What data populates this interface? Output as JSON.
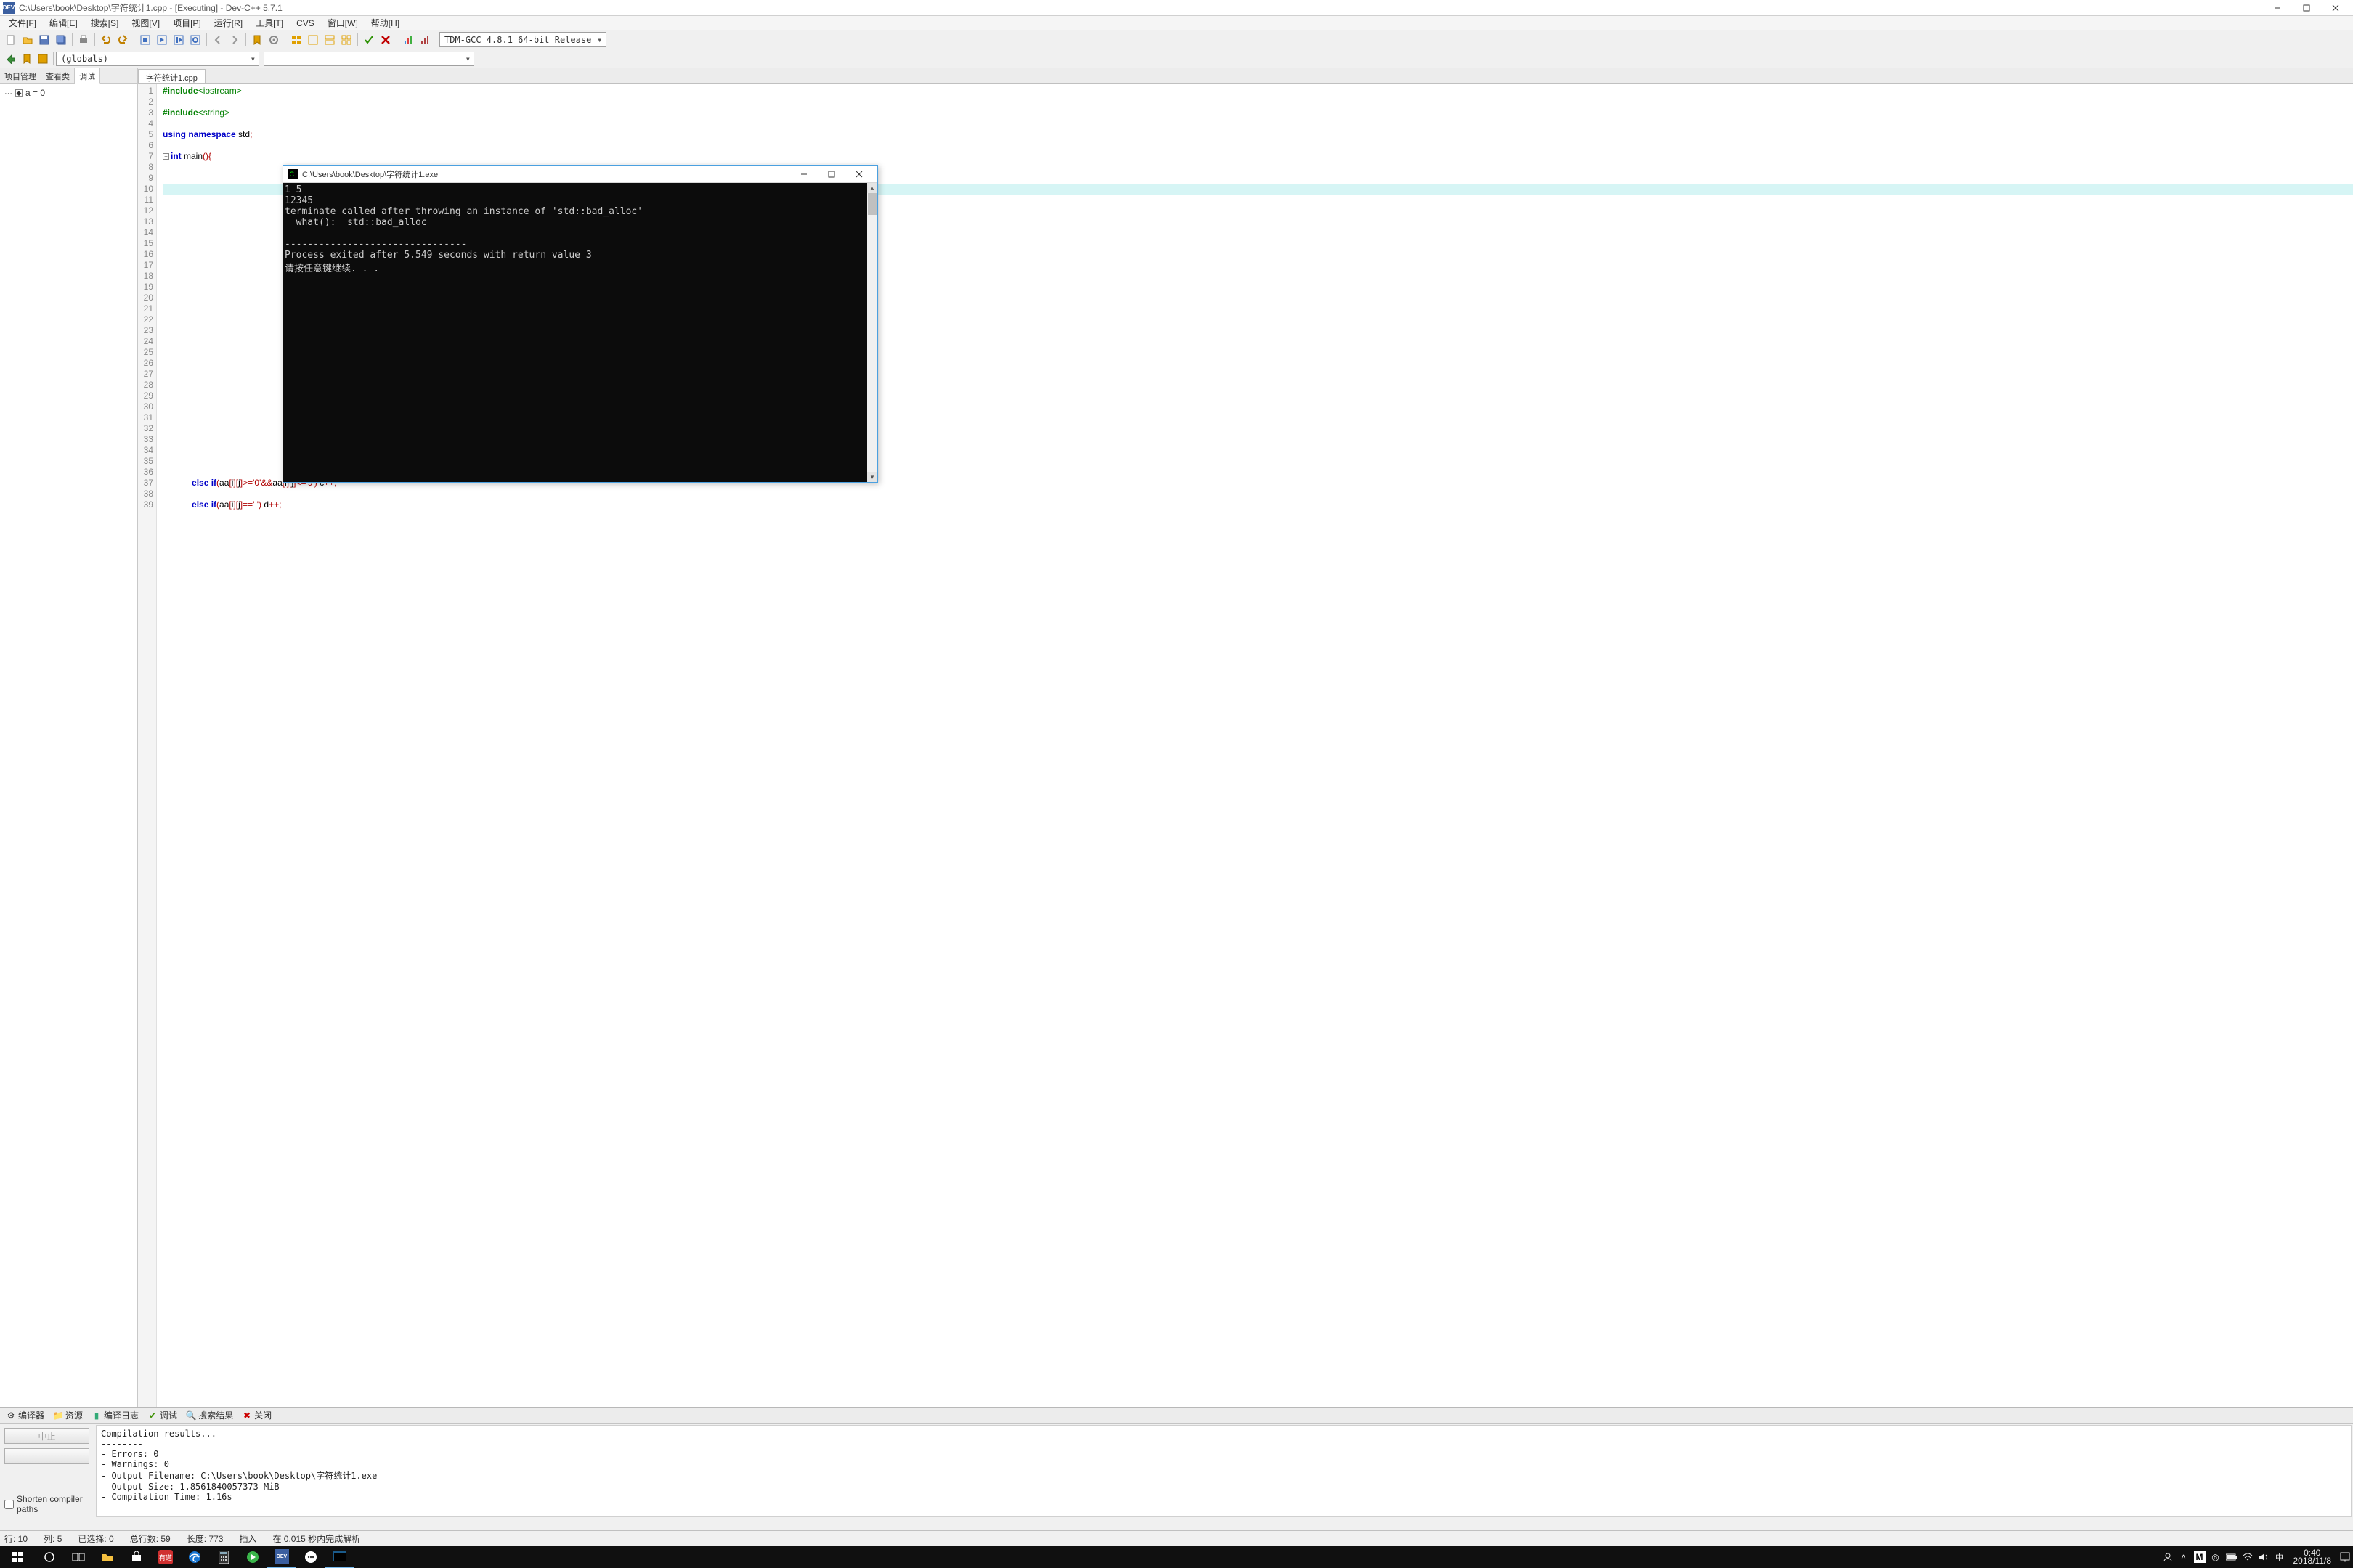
{
  "window": {
    "title": "C:\\Users\\book\\Desktop\\字符统计1.cpp - [Executing] - Dev-C++ 5.7.1",
    "app_icon_text": "DEV"
  },
  "menu": [
    "文件[F]",
    "编辑[E]",
    "搜索[S]",
    "视图[V]",
    "项目[P]",
    "运行[R]",
    "工具[T]",
    "CVS",
    "窗口[W]",
    "帮助[H]"
  ],
  "compiler_select": "TDM-GCC 4.8.1 64-bit Release",
  "scope_combo": "(globals)",
  "sidebar": {
    "tabs": [
      "项目管理",
      "查看类",
      "调试"
    ],
    "active_tab": 2,
    "tree_item": "a = 0"
  },
  "file_tab": "字符统计1.cpp",
  "code": {
    "lines": [
      {
        "n": 1,
        "html": "<span class='pp'>#include</span><span class='str'>&lt;iostream&gt;</span>"
      },
      {
        "n": 2,
        "html": ""
      },
      {
        "n": 3,
        "html": "<span class='pp'>#include</span><span class='str'>&lt;string&gt;</span>"
      },
      {
        "n": 4,
        "html": ""
      },
      {
        "n": 5,
        "html": "<span class='kw'>using</span> <span class='kw'>namespace</span> std<span class='op'>;</span>"
      },
      {
        "n": 6,
        "html": ""
      },
      {
        "n": 7,
        "html": "<span class='kw'>int</span> main<span class='op'>(){</span>",
        "fold": true
      },
      {
        "n": 8,
        "html": ""
      },
      {
        "n": 9,
        "html": ""
      },
      {
        "n": 10,
        "html": "",
        "hl": true
      },
      {
        "n": 11,
        "html": ""
      },
      {
        "n": 12,
        "html": ""
      },
      {
        "n": 13,
        "html": ""
      },
      {
        "n": 14,
        "html": ""
      },
      {
        "n": 15,
        "html": ""
      },
      {
        "n": 16,
        "html": ""
      },
      {
        "n": 17,
        "html": ""
      },
      {
        "n": 18,
        "html": ""
      },
      {
        "n": 19,
        "html": ""
      },
      {
        "n": 20,
        "html": ""
      },
      {
        "n": 21,
        "html": ""
      },
      {
        "n": 22,
        "html": ""
      },
      {
        "n": 23,
        "html": ""
      },
      {
        "n": 24,
        "html": ""
      },
      {
        "n": 25,
        "html": ""
      },
      {
        "n": 26,
        "html": ""
      },
      {
        "n": 27,
        "html": ""
      },
      {
        "n": 28,
        "html": ""
      },
      {
        "n": 29,
        "html": ""
      },
      {
        "n": 30,
        "html": ""
      },
      {
        "n": 31,
        "html": ""
      },
      {
        "n": 32,
        "html": ""
      },
      {
        "n": 33,
        "html": ""
      },
      {
        "n": 34,
        "html": ""
      },
      {
        "n": 35,
        "html": ""
      },
      {
        "n": 36,
        "html": ""
      },
      {
        "n": 37,
        "html": "            <span class='kw'>else if</span><span class='op'>(</span>aa<span class='op'>[</span>i<span class='op'>][</span>j<span class='op'>]&gt;=</span><span class='num'>'0'</span><span class='op'>&amp;&amp;</span>aa<span class='op'>[</span>i<span class='op'>][</span>j<span class='op'>]&lt;=</span><span class='num'>'9'</span><span class='op'>)</span> c<span class='op'>++;</span>"
      },
      {
        "n": 38,
        "html": ""
      },
      {
        "n": 39,
        "html": "            <span class='kw'>else if</span><span class='op'>(</span>aa<span class='op'>[</span>i<span class='op'>][</span>j<span class='op'>]==</span><span class='num'>' '</span><span class='op'>)</span> d<span class='op'>++;</span>"
      }
    ]
  },
  "console": {
    "title": "C:\\Users\\book\\Desktop\\字符统计1.exe",
    "lines": [
      "1 5",
      "12345",
      "terminate called after throwing an instance of 'std::bad_alloc'",
      "  what():  std::bad_alloc",
      "",
      "--------------------------------",
      "Process exited after 5.549 seconds with return value 3",
      "请按任意键继续. . ."
    ]
  },
  "bottom": {
    "tabs": [
      "编译器",
      "资源",
      "编译日志",
      "调试",
      "搜索结果",
      "关闭"
    ],
    "stop_btn": "中止",
    "check_label": "Shorten compiler paths",
    "output": "Compilation results...\n--------\n- Errors: 0\n- Warnings: 0\n- Output Filename: C:\\Users\\book\\Desktop\\字符统计1.exe\n- Output Size: 1.8561840057373 MiB\n- Compilation Time: 1.16s"
  },
  "status": {
    "line": "行:   10",
    "col": "列:   5",
    "sel": "已选择:   0",
    "total": "总行数:   59",
    "len": "长度:   773",
    "ins": "插入",
    "parse": "在 0.015 秒内完成解析"
  },
  "taskbar": {
    "clock_time": "0:40",
    "clock_date": "2018/11/8",
    "ime": "M"
  }
}
